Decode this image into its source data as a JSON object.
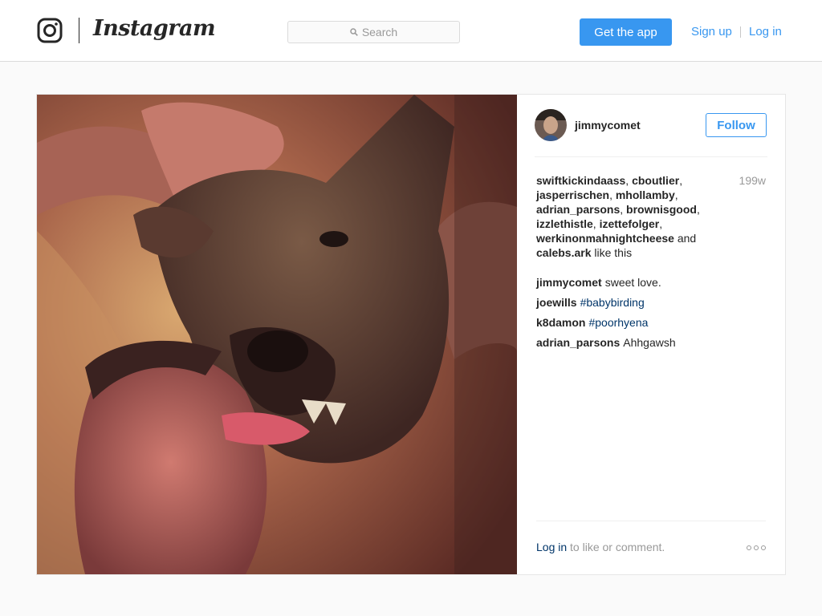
{
  "header": {
    "brand": "Instagram",
    "search_placeholder": "Search",
    "get_app_label": "Get the app",
    "sign_up_label": "Sign up",
    "log_in_label": "Log in"
  },
  "post": {
    "author": "jimmycomet",
    "follow_label": "Follow",
    "age": "199w",
    "likers": [
      "swiftkickindaass",
      "cboutlier",
      "jasperrischen",
      "mhollamby",
      "adrian_parsons",
      "brownisgood",
      "izzlethistle",
      "izettefolger",
      "werkinonmahnightcheese"
    ],
    "likers_conjunction": "and",
    "last_liker": "calebs.ark",
    "likes_suffix": "like this",
    "comments": [
      {
        "user": "jimmycomet",
        "text": "sweet love.",
        "hashtag": ""
      },
      {
        "user": "joewills",
        "text": "",
        "hashtag": "#babybirding"
      },
      {
        "user": "k8damon",
        "text": "",
        "hashtag": "#poorhyena"
      },
      {
        "user": "adrian_parsons",
        "text": "Ahhgawsh",
        "hashtag": ""
      }
    ],
    "footer_login": "Log in",
    "footer_text": "to like or comment."
  },
  "colors": {
    "accent": "#3897f0",
    "link_dark": "#003569",
    "muted": "#999999",
    "border": "#dbdbdb"
  },
  "icons": {
    "logo": "instagram-camera-icon",
    "search": "search-icon",
    "more": "more-options-icon"
  }
}
